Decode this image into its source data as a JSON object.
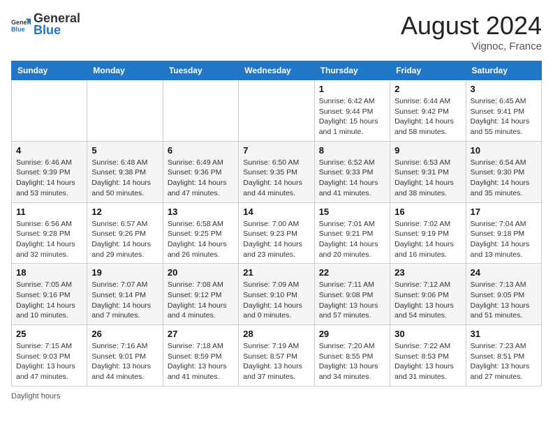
{
  "header": {
    "logo_general": "General",
    "logo_blue": "Blue",
    "month_title": "August 2024",
    "location": "Vignoc, France"
  },
  "footer": {
    "daylight_label": "Daylight hours"
  },
  "weekdays": [
    "Sunday",
    "Monday",
    "Tuesday",
    "Wednesday",
    "Thursday",
    "Friday",
    "Saturday"
  ],
  "weeks": [
    [
      {
        "day": "",
        "info": ""
      },
      {
        "day": "",
        "info": ""
      },
      {
        "day": "",
        "info": ""
      },
      {
        "day": "",
        "info": ""
      },
      {
        "day": "1",
        "info": "Sunrise: 6:42 AM\nSunset: 9:44 PM\nDaylight: 15 hours and 1 minute."
      },
      {
        "day": "2",
        "info": "Sunrise: 6:44 AM\nSunset: 9:42 PM\nDaylight: 14 hours and 58 minutes."
      },
      {
        "day": "3",
        "info": "Sunrise: 6:45 AM\nSunset: 9:41 PM\nDaylight: 14 hours and 55 minutes."
      }
    ],
    [
      {
        "day": "4",
        "info": "Sunrise: 6:46 AM\nSunset: 9:39 PM\nDaylight: 14 hours and 53 minutes."
      },
      {
        "day": "5",
        "info": "Sunrise: 6:48 AM\nSunset: 9:38 PM\nDaylight: 14 hours and 50 minutes."
      },
      {
        "day": "6",
        "info": "Sunrise: 6:49 AM\nSunset: 9:36 PM\nDaylight: 14 hours and 47 minutes."
      },
      {
        "day": "7",
        "info": "Sunrise: 6:50 AM\nSunset: 9:35 PM\nDaylight: 14 hours and 44 minutes."
      },
      {
        "day": "8",
        "info": "Sunrise: 6:52 AM\nSunset: 9:33 PM\nDaylight: 14 hours and 41 minutes."
      },
      {
        "day": "9",
        "info": "Sunrise: 6:53 AM\nSunset: 9:31 PM\nDaylight: 14 hours and 38 minutes."
      },
      {
        "day": "10",
        "info": "Sunrise: 6:54 AM\nSunset: 9:30 PM\nDaylight: 14 hours and 35 minutes."
      }
    ],
    [
      {
        "day": "11",
        "info": "Sunrise: 6:56 AM\nSunset: 9:28 PM\nDaylight: 14 hours and 32 minutes."
      },
      {
        "day": "12",
        "info": "Sunrise: 6:57 AM\nSunset: 9:26 PM\nDaylight: 14 hours and 29 minutes."
      },
      {
        "day": "13",
        "info": "Sunrise: 6:58 AM\nSunset: 9:25 PM\nDaylight: 14 hours and 26 minutes."
      },
      {
        "day": "14",
        "info": "Sunrise: 7:00 AM\nSunset: 9:23 PM\nDaylight: 14 hours and 23 minutes."
      },
      {
        "day": "15",
        "info": "Sunrise: 7:01 AM\nSunset: 9:21 PM\nDaylight: 14 hours and 20 minutes."
      },
      {
        "day": "16",
        "info": "Sunrise: 7:02 AM\nSunset: 9:19 PM\nDaylight: 14 hours and 16 minutes."
      },
      {
        "day": "17",
        "info": "Sunrise: 7:04 AM\nSunset: 9:18 PM\nDaylight: 14 hours and 13 minutes."
      }
    ],
    [
      {
        "day": "18",
        "info": "Sunrise: 7:05 AM\nSunset: 9:16 PM\nDaylight: 14 hours and 10 minutes."
      },
      {
        "day": "19",
        "info": "Sunrise: 7:07 AM\nSunset: 9:14 PM\nDaylight: 14 hours and 7 minutes."
      },
      {
        "day": "20",
        "info": "Sunrise: 7:08 AM\nSunset: 9:12 PM\nDaylight: 14 hours and 4 minutes."
      },
      {
        "day": "21",
        "info": "Sunrise: 7:09 AM\nSunset: 9:10 PM\nDaylight: 14 hours and 0 minutes."
      },
      {
        "day": "22",
        "info": "Sunrise: 7:11 AM\nSunset: 9:08 PM\nDaylight: 13 hours and 57 minutes."
      },
      {
        "day": "23",
        "info": "Sunrise: 7:12 AM\nSunset: 9:06 PM\nDaylight: 13 hours and 54 minutes."
      },
      {
        "day": "24",
        "info": "Sunrise: 7:13 AM\nSunset: 9:05 PM\nDaylight: 13 hours and 51 minutes."
      }
    ],
    [
      {
        "day": "25",
        "info": "Sunrise: 7:15 AM\nSunset: 9:03 PM\nDaylight: 13 hours and 47 minutes."
      },
      {
        "day": "26",
        "info": "Sunrise: 7:16 AM\nSunset: 9:01 PM\nDaylight: 13 hours and 44 minutes."
      },
      {
        "day": "27",
        "info": "Sunrise: 7:18 AM\nSunset: 8:59 PM\nDaylight: 13 hours and 41 minutes."
      },
      {
        "day": "28",
        "info": "Sunrise: 7:19 AM\nSunset: 8:57 PM\nDaylight: 13 hours and 37 minutes."
      },
      {
        "day": "29",
        "info": "Sunrise: 7:20 AM\nSunset: 8:55 PM\nDaylight: 13 hours and 34 minutes."
      },
      {
        "day": "30",
        "info": "Sunrise: 7:22 AM\nSunset: 8:53 PM\nDaylight: 13 hours and 31 minutes."
      },
      {
        "day": "31",
        "info": "Sunrise: 7:23 AM\nSunset: 8:51 PM\nDaylight: 13 hours and 27 minutes."
      }
    ]
  ]
}
